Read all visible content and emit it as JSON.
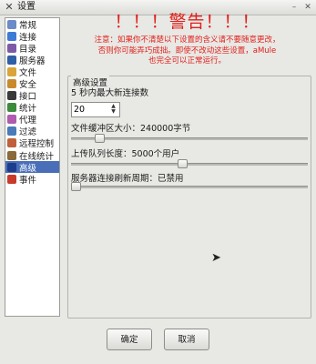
{
  "window": {
    "title": "设置",
    "minimize_glyph": "–",
    "close_glyph": "✕"
  },
  "sidebar": {
    "items": [
      {
        "label": "常规",
        "icon": "general-icon",
        "color": "#6a8ac8"
      },
      {
        "label": "连接",
        "icon": "connection-icon",
        "color": "#3d7ad6"
      },
      {
        "label": "目录",
        "icon": "directories-icon",
        "color": "#7c5aa8"
      },
      {
        "label": "服务器",
        "icon": "server-icon",
        "color": "#2f5fa6"
      },
      {
        "label": "文件",
        "icon": "files-icon",
        "color": "#d9a43a"
      },
      {
        "label": "安全",
        "icon": "security-icon",
        "color": "#c98a2c"
      },
      {
        "label": "接口",
        "icon": "gui-icon",
        "color": "#3a3a3a"
      },
      {
        "label": "统计",
        "icon": "statistics-icon",
        "color": "#3c8a3c"
      },
      {
        "label": "代理",
        "icon": "proxy-icon",
        "color": "#b05ab0"
      },
      {
        "label": "过滤",
        "icon": "filter-icon",
        "color": "#4a7ab8"
      },
      {
        "label": "远程控制",
        "icon": "remote-control-icon",
        "color": "#c0603a"
      },
      {
        "label": "在线统计",
        "icon": "online-stats-icon",
        "color": "#8a6a3a"
      },
      {
        "label": "高级",
        "icon": "advanced-icon",
        "color": "#1c3c8c",
        "selected": true
      },
      {
        "label": "事件",
        "icon": "events-icon",
        "color": "#c83a2a"
      }
    ]
  },
  "warning": {
    "title": "！！！警告！！！",
    "line1": "注意：如果你不清楚以下设置的含义请不要随意更改，",
    "line2": "否则你可能弄巧成拙。即使不改动这些设置，aMule",
    "line3": "也完全可以正常运行。"
  },
  "advanced": {
    "group_title": "高级设置",
    "max_new_connections_label": "5 秒内最大新连接数",
    "max_new_connections_value": "20",
    "file_buffer_label": "文件缓冲区大小：240000字节",
    "file_buffer_level": 0.12,
    "upload_queue_label": "上传队列长度：5000个用户",
    "upload_queue_level": 0.47,
    "server_refresh_label": "服务器连接刷新周期：已禁用",
    "server_refresh_level": 0.02
  },
  "buttons": {
    "ok": "确定",
    "cancel": "取消"
  }
}
